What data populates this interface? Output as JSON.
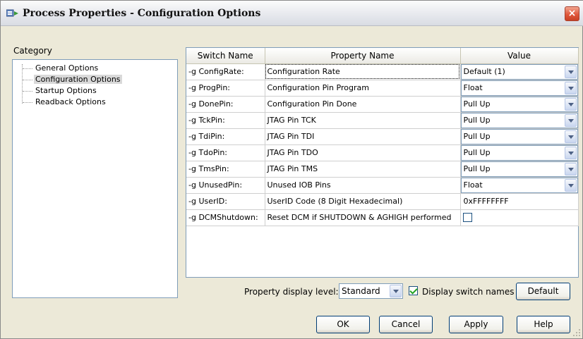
{
  "window": {
    "title": "Process Properties - Configuration Options",
    "close_glyph": "×"
  },
  "category": {
    "label": "Category",
    "items": [
      {
        "label": "General Options",
        "selected": false
      },
      {
        "label": "Configuration Options",
        "selected": true
      },
      {
        "label": "Startup Options",
        "selected": false
      },
      {
        "label": "Readback Options",
        "selected": false
      }
    ]
  },
  "grid": {
    "columns": [
      "Switch Name",
      "Property Name",
      "Value"
    ],
    "rows": [
      {
        "switch": "-g ConfigRate:",
        "property": "Configuration Rate",
        "value": "Default (1)",
        "kind": "combo"
      },
      {
        "switch": "-g ProgPin:",
        "property": "Configuration Pin Program",
        "value": "Float",
        "kind": "combo"
      },
      {
        "switch": "-g DonePin:",
        "property": "Configuration Pin Done",
        "value": "Pull Up",
        "kind": "combo"
      },
      {
        "switch": "-g TckPin:",
        "property": "JTAG Pin TCK",
        "value": "Pull Up",
        "kind": "combo"
      },
      {
        "switch": "-g TdiPin:",
        "property": "JTAG Pin TDI",
        "value": "Pull Up",
        "kind": "combo"
      },
      {
        "switch": "-g TdoPin:",
        "property": "JTAG Pin TDO",
        "value": "Pull Up",
        "kind": "combo"
      },
      {
        "switch": "-g TmsPin:",
        "property": "JTAG Pin TMS",
        "value": "Pull Up",
        "kind": "combo"
      },
      {
        "switch": "-g UnusedPin:",
        "property": "Unused IOB Pins",
        "value": "Float",
        "kind": "combo"
      },
      {
        "switch": "-g UserID:",
        "property": "UserID Code (8 Digit Hexadecimal)",
        "value": "0xFFFFFFFF",
        "kind": "text"
      },
      {
        "switch": "-g DCMShutdown:",
        "property": "Reset DCM if SHUTDOWN & AGHIGH performed",
        "value": "",
        "kind": "checkbox",
        "checked": false
      }
    ]
  },
  "footer": {
    "display_level_label": "Property display level:",
    "display_level_value": "Standard",
    "display_switch_names_label": "Display switch names",
    "display_switch_names_checked": true,
    "default_button": "Default"
  },
  "buttons": {
    "ok": "OK",
    "cancel": "Cancel",
    "apply": "Apply",
    "help": "Help"
  }
}
